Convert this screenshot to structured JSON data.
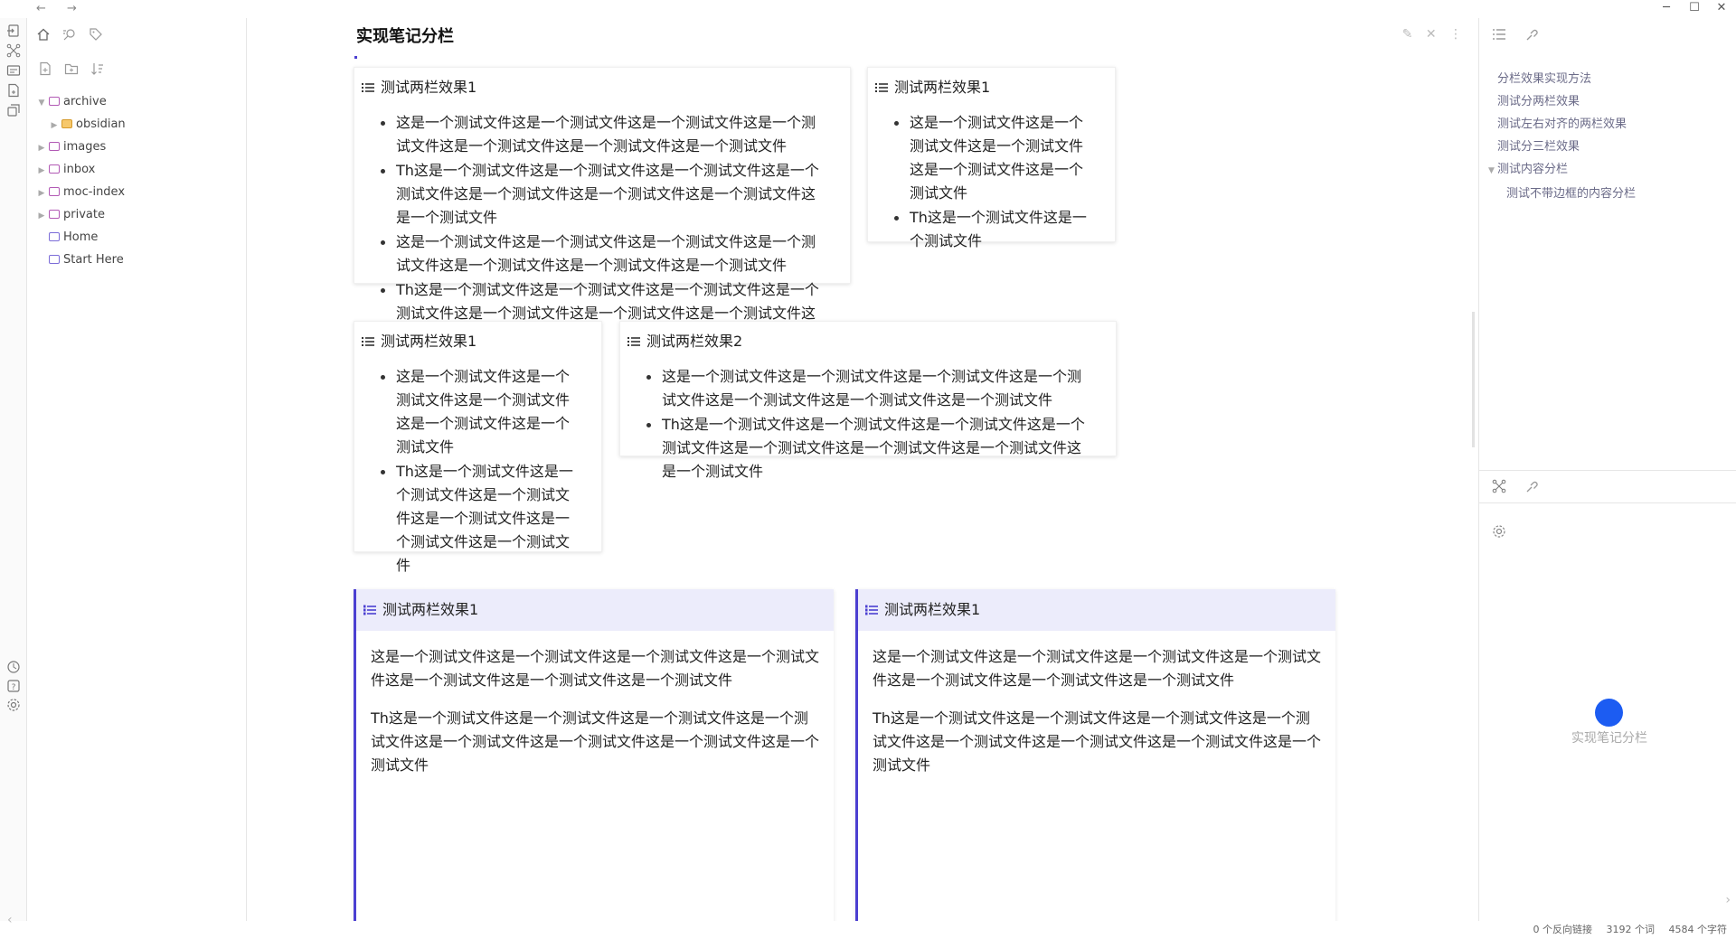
{
  "window": {
    "back": "←",
    "forward": "→",
    "minimize": "─",
    "maximize": "☐",
    "close": "✕"
  },
  "ribbon": {
    "top_icons": [
      "open-quick-switcher-icon",
      "graph-view-icon",
      "canvas-icon",
      "daily-note-icon",
      "templates-icon"
    ],
    "bottom_icons": [
      "vault-icon",
      "help-icon",
      "settings-icon"
    ]
  },
  "sidebar": {
    "tab_icons": [
      "files-icon",
      "search-icon",
      "tag-icon"
    ],
    "tool_icons": [
      "new-note-icon",
      "new-folder-icon",
      "sort-icon"
    ],
    "tree": [
      {
        "label": "archive",
        "type": "folder-open",
        "depth": 0,
        "caret": "▼"
      },
      {
        "label": "obsidian",
        "type": "folder",
        "depth": 1,
        "caret": "▶"
      },
      {
        "label": "images",
        "type": "folder-closed",
        "depth": 0,
        "caret": "▶"
      },
      {
        "label": "inbox",
        "type": "folder-closed",
        "depth": 0,
        "caret": "▶"
      },
      {
        "label": "moc-index",
        "type": "folder-closed",
        "depth": 0,
        "caret": "▶"
      },
      {
        "label": "private",
        "type": "folder-closed",
        "depth": 0,
        "caret": "▶"
      },
      {
        "label": "Home",
        "type": "note",
        "depth": 0,
        "caret": ""
      },
      {
        "label": "Start Here",
        "type": "note",
        "depth": 0,
        "caret": ""
      }
    ]
  },
  "main": {
    "title": "实现笔记分栏",
    "cards": [
      {
        "title": "测试两栏效果1",
        "items": [
          "这是一个测试文件这是一个测试文件这是一个测试文件这是一个测试文件这是一个测试文件这是一个测试文件这是一个测试文件",
          "Th这是一个测试文件这是一个测试文件这是一个测试文件这是一个测试文件这是一个测试文件这是一个测试文件这是一个测试文件这是一个测试文件",
          "这是一个测试文件这是一个测试文件这是一个测试文件这是一个测试文件这是一个测试文件这是一个测试文件这是一个测试文件",
          "Th这是一个测试文件这是一个测试文件这是一个测试文件这是一个测试文件这是一个测试文件这是一个测试文件这是一个测试文件这是一个测试文件"
        ]
      },
      {
        "title": "测试两栏效果1",
        "items": [
          "这是一个测试文件这是一个测试文件这是一个测试文件这是一个测试文件这是一个测试文件",
          "Th这是一个测试文件这是一个测试文件"
        ]
      },
      {
        "title": "测试两栏效果1",
        "items": [
          "这是一个测试文件这是一个测试文件这是一个测试文件这是一个测试文件这是一个测试文件",
          "Th这是一个测试文件这是一个测试文件这是一个测试文件这是一个测试文件这是一个测试文件这是一个测试文件"
        ]
      },
      {
        "title": "测试两栏效果2",
        "items": [
          "这是一个测试文件这是一个测试文件这是一个测试文件这是一个测试文件这是一个测试文件这是一个测试文件这是一个测试文件",
          "Th这是一个测试文件这是一个测试文件这是一个测试文件这是一个测试文件这是一个测试文件这是一个测试文件这是一个测试文件这是一个测试文件"
        ]
      },
      {
        "title": "测试两栏效果1",
        "paragraphs": [
          "这是一个测试文件这是一个测试文件这是一个测试文件这是一个测试文件这是一个测试文件这是一个测试文件这是一个测试文件",
          "Th这是一个测试文件这是一个测试文件这是一个测试文件这是一个测试文件这是一个测试文件这是一个测试文件这是一个测试文件这是一个测试文件"
        ]
      },
      {
        "title": "测试两栏效果1",
        "paragraphs": [
          "这是一个测试文件这是一个测试文件这是一个测试文件这是一个测试文件这是一个测试文件这是一个测试文件这是一个测试文件",
          "Th这是一个测试文件这是一个测试文件这是一个测试文件这是一个测试文件这是一个测试文件这是一个测试文件这是一个测试文件这是一个测试文件"
        ]
      }
    ]
  },
  "right_panel": {
    "tab_icons": [
      "outline-icon",
      "backlinks-icon"
    ],
    "outline": [
      {
        "label": "分栏效果实现方法",
        "depth": 0,
        "caret": ""
      },
      {
        "label": "测试分两栏效果",
        "depth": 0,
        "caret": ""
      },
      {
        "label": "测试左右对齐的两栏效果",
        "depth": 0,
        "caret": ""
      },
      {
        "label": "测试分三栏效果",
        "depth": 0,
        "caret": ""
      },
      {
        "label": "测试内容分栏",
        "depth": 0,
        "caret": "▼"
      },
      {
        "label": "测试不带边框的内容分栏",
        "depth": 1,
        "caret": ""
      }
    ],
    "lower_tab_icons": [
      "local-graph-icon",
      "outgoing-links-icon"
    ],
    "graph_label": "实现笔记分栏"
  },
  "status": {
    "backlinks": "0 个反向链接",
    "words": "3192 个词",
    "chars": "4584 个字符"
  },
  "colors": {
    "accent": "#4b3fd1",
    "graph_node": "#1c5cf2",
    "callout_bg": "#ececfb"
  }
}
